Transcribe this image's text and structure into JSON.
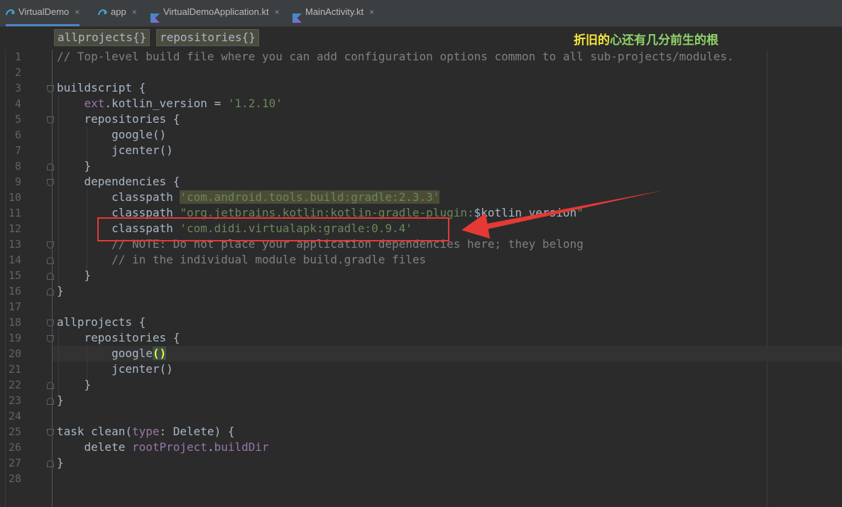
{
  "tabs": [
    {
      "label": "VirtualDemo",
      "icon": "gradle-icon",
      "active": true
    },
    {
      "label": "app",
      "icon": "gradle-icon",
      "active": false
    },
    {
      "label": "VirtualDemoApplication.kt",
      "icon": "kotlin-file-icon",
      "active": false
    },
    {
      "label": "MainActivity.kt",
      "icon": "kotlin-file-icon",
      "active": false
    }
  ],
  "tab_close": "×",
  "breadcrumb": [
    "allprojects{}",
    "repositories{}"
  ],
  "watermark": {
    "part1": "折旧的",
    "part2": "心还有几分前生的根"
  },
  "line_numbers": [
    "1",
    "2",
    "3",
    "4",
    "5",
    "6",
    "7",
    "8",
    "9",
    "10",
    "11",
    "12",
    "13",
    "14",
    "15",
    "16",
    "17",
    "18",
    "19",
    "20",
    "21",
    "22",
    "23",
    "24",
    "25",
    "26",
    "27",
    "28"
  ],
  "code": {
    "l1": "// Top-level build file where you can add configuration options common to all sub-projects/modules.",
    "l3": "buildscript {",
    "l4a": "    ",
    "l4b": "ext",
    "l4c": ".kotlin_version = ",
    "l4d": "'1.2.10'",
    "l5": "    repositories {",
    "l6": "        google()",
    "l7": "        jcenter()",
    "l8": "    }",
    "l9": "    dependencies {",
    "l10a": "        classpath ",
    "l10b": "'com.android.tools.build:gradle:2.3.3'",
    "l11a": "        classpath ",
    "l11b": "\"org.jetbrains.kotlin:kotlin-gradle-plugin:",
    "l11c": "$kotlin_version",
    "l11d": "\"",
    "l12a": "        classpath ",
    "l12b": "'com.didi.virtualapk:gradle:0.9.4'",
    "l13": "        // NOTE: Do not place your application dependencies here; they belong",
    "l14": "        // in the individual module build.gradle files",
    "l15": "    }",
    "l16": "}",
    "l18": "allprojects {",
    "l19": "    repositories {",
    "l20a": "        google",
    "l20b": "()",
    "l21": "        jcenter()",
    "l22": "    }",
    "l23": "}",
    "l25a": "task clean(",
    "l25b": "type",
    "l25c": ": Delete) {",
    "l26a": "    delete ",
    "l26b": "rootProject",
    "l26c": ".",
    "l26d": "buildDir",
    "l27": "}"
  },
  "colors": {
    "background": "#2b2b2b",
    "comment": "#808080",
    "string": "#6a8759",
    "property": "#9876aa",
    "annotation_box": "#e53935",
    "active_tab_underline": "#4a88c7"
  }
}
